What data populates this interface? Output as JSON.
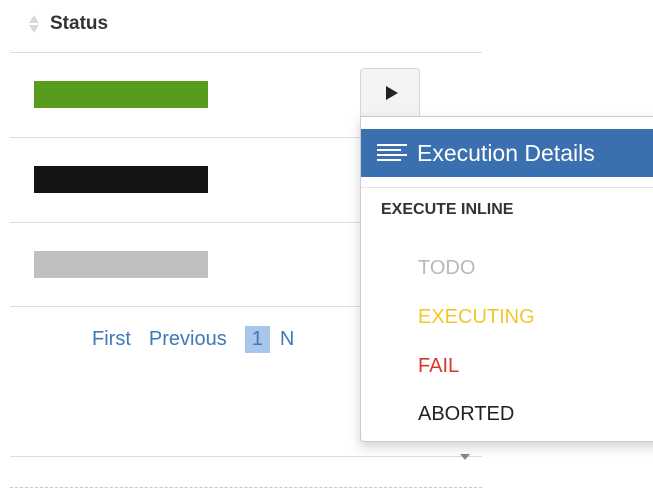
{
  "table": {
    "header": {
      "status_label": "Status"
    },
    "rows": [
      {
        "status_color": "#579c1c"
      },
      {
        "status_color": "#141414"
      },
      {
        "status_color": "#bfbfbf"
      }
    ]
  },
  "pagination": {
    "first_label": "First",
    "previous_label": "Previous",
    "current_page": "1",
    "next_label": "N"
  },
  "dropdown": {
    "active_item_label": "Execution Details",
    "section_header": "EXECUTE INLINE",
    "items": [
      {
        "label": "TODO",
        "color": "#b9b9b9"
      },
      {
        "label": "EXECUTING",
        "color": "#f2c72c"
      },
      {
        "label": "FAIL",
        "color": "#d23a2f"
      },
      {
        "label": "ABORTED",
        "color": "#222222"
      }
    ]
  },
  "colors": {
    "accent": "#3a6fb0",
    "link": "#3f7ab8"
  }
}
